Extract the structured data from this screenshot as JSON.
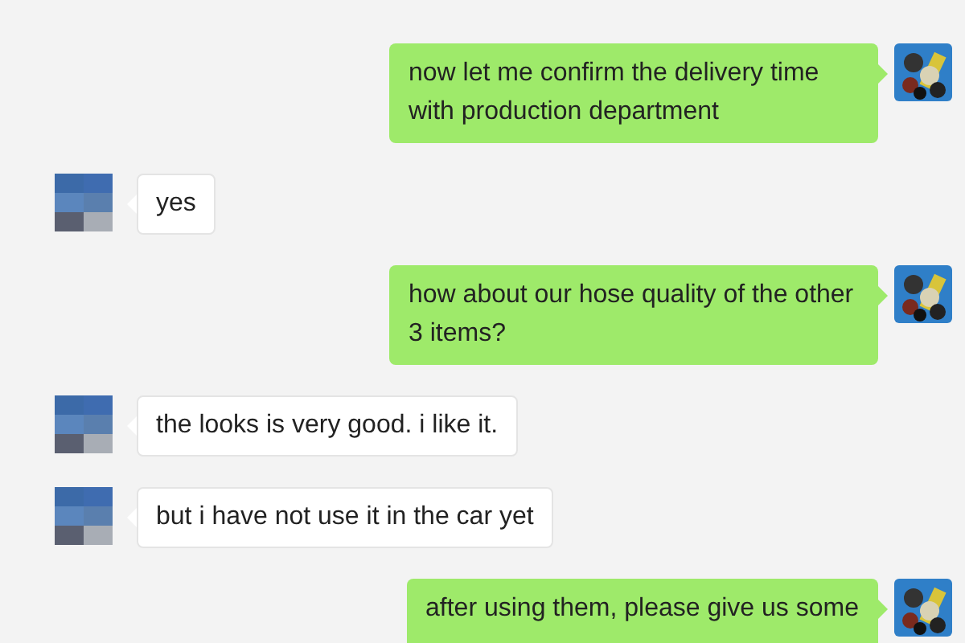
{
  "messages": [
    {
      "kind": "sent",
      "text": "now let me confirm the delivery time with production department"
    },
    {
      "kind": "received",
      "text": "yes"
    },
    {
      "kind": "sent",
      "text": "how about our hose quality of the other 3 items?"
    },
    {
      "kind": "received",
      "text": "the looks is very good. i like it."
    },
    {
      "kind": "received",
      "text": "but i have not use it in the car yet"
    },
    {
      "kind": "sent",
      "text": "after using them, please give us some"
    }
  ]
}
